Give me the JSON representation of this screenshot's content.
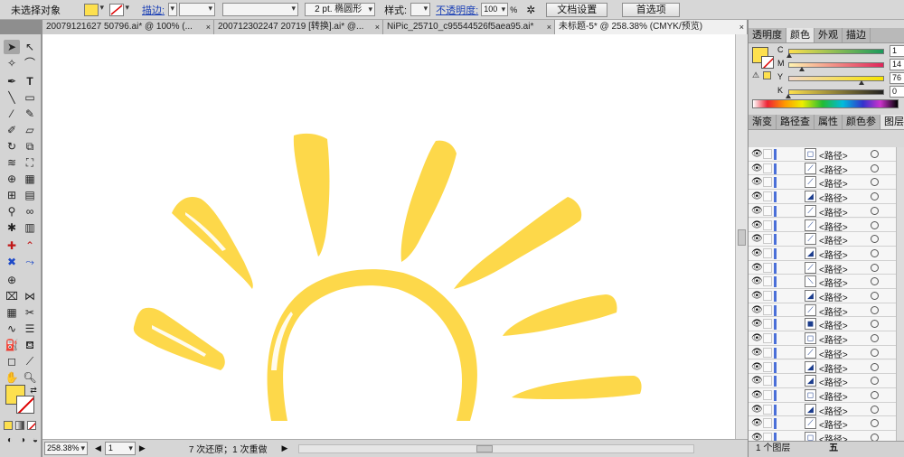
{
  "control_bar": {
    "selection": "未选择对象",
    "fill_color": "#fde04e",
    "stroke_label": "描边:",
    "stroke_weight": "",
    "brush_label": "2 pt. 椭圆形",
    "style_label": "样式:",
    "opacity_label": "不透明度:",
    "opacity_value": "100",
    "opacity_unit": "%",
    "doc_setup_button": "文档设置",
    "prefs_button": "首选项"
  },
  "tabs": [
    {
      "label": "20079121627 50796.ai* @ 100% (..."
    },
    {
      "label": "200712302247 20719 [转换].ai* @..."
    },
    {
      "label": "NiPic_25710_c95544526f5aea95.ai*"
    },
    {
      "label": "未标题-5* @ 258.38% (CMYK/预览)"
    }
  ],
  "status": {
    "zoom": "258.38%",
    "artboard": "1",
    "message": "7 次还原；1 次重做"
  },
  "color_panel": {
    "tabs": [
      "透明度",
      "颜色",
      "外观",
      "描边"
    ],
    "active_tab": "颜色",
    "channels": [
      {
        "name": "C",
        "value": "1",
        "unit": "%",
        "pos": 0.01
      },
      {
        "name": "M",
        "value": "14",
        "unit": "%",
        "pos": 0.14
      },
      {
        "name": "Y",
        "value": "76",
        "unit": "%",
        "pos": 0.76
      },
      {
        "name": "K",
        "value": "0",
        "unit": "%",
        "pos": 0.0
      }
    ]
  },
  "layers_panel": {
    "tabs": [
      "渐变",
      "路径查",
      "属性",
      "颜色参",
      "图层"
    ],
    "active_tab": "图层",
    "item_label": "<路径>",
    "footer": "1 个图层",
    "rows": [
      {
        "name": "<路径>"
      },
      {
        "name": "<路径>"
      },
      {
        "name": "<路径>"
      },
      {
        "name": "<路径>"
      },
      {
        "name": "<路径>"
      },
      {
        "name": "<路径>"
      },
      {
        "name": "<路径>"
      },
      {
        "name": "<路径>"
      },
      {
        "name": "<路径>"
      },
      {
        "name": "<路径>"
      },
      {
        "name": "<路径>"
      },
      {
        "name": "<路径>"
      },
      {
        "name": "<路径>"
      },
      {
        "name": "<路径>"
      },
      {
        "name": "<路径>"
      },
      {
        "name": "<路径>"
      },
      {
        "name": "<路径>"
      },
      {
        "name": "<路径>"
      },
      {
        "name": "<路径>"
      },
      {
        "name": "<路径>"
      },
      {
        "name": "<路径>"
      }
    ]
  },
  "colors": {
    "art_yellow": "#fdd84a",
    "fill_swatch": "#fde04e"
  },
  "watermark": "五"
}
